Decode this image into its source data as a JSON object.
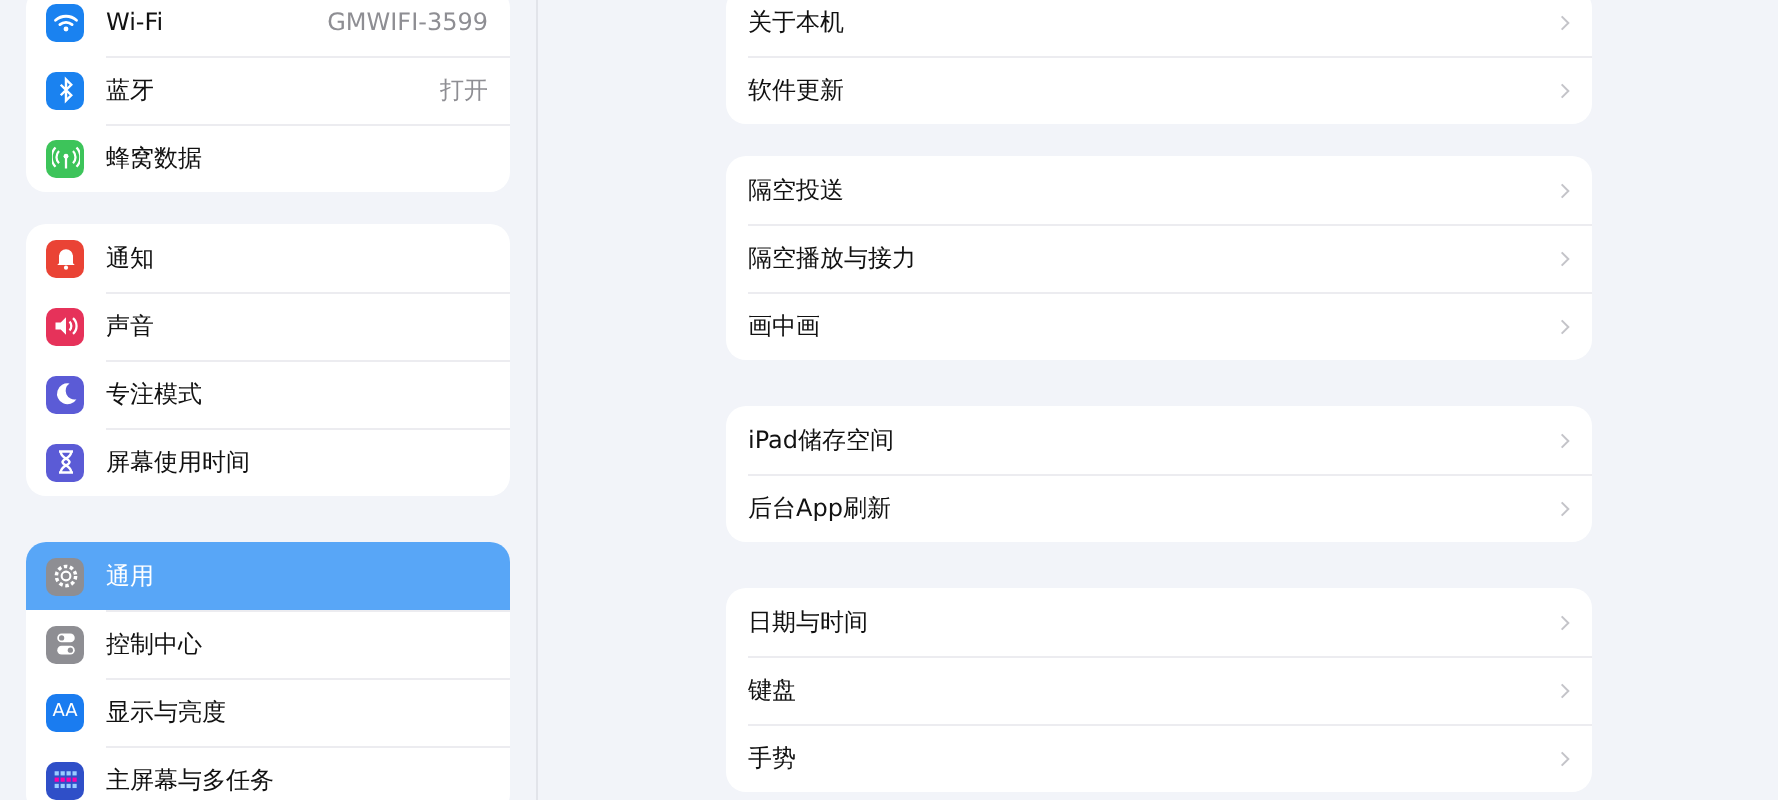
{
  "sidebar": {
    "groups": [
      {
        "items": [
          {
            "kind": "wifi",
            "color": "#1a82f0",
            "label": "Wi-Fi",
            "value": "GMWIFI-3599",
            "selected": false
          },
          {
            "kind": "bluetooth",
            "color": "#1a82f0",
            "label": "蓝牙",
            "value": "打开",
            "selected": false
          },
          {
            "kind": "cellular",
            "color": "#3dc45a",
            "label": "蜂窝数据",
            "selected": false
          }
        ]
      },
      {
        "items": [
          {
            "kind": "bell",
            "color": "#ea4335",
            "label": "通知",
            "selected": false
          },
          {
            "kind": "speaker",
            "color": "#e6325a",
            "label": "声音",
            "selected": false
          },
          {
            "kind": "moon",
            "color": "#5b5bd6",
            "label": "专注模式",
            "selected": false
          },
          {
            "kind": "hourglass",
            "color": "#5b5bd6",
            "label": "屏幕使用时间",
            "selected": false
          }
        ]
      },
      {
        "items": [
          {
            "kind": "gear",
            "color": "#8e8e93",
            "label": "通用",
            "selected": true
          },
          {
            "kind": "toggles",
            "color": "#8e8e93",
            "label": "控制中心",
            "selected": false
          },
          {
            "kind": "text",
            "color": "#1a7cf0",
            "label": "显示与亮度",
            "glyph": "AA",
            "selected": false
          },
          {
            "kind": "grid",
            "color": "#2f4fc8",
            "label": "主屏幕与多任务",
            "selected": false
          }
        ]
      }
    ]
  },
  "detail": {
    "groups": [
      {
        "items": [
          "关于本机",
          "软件更新"
        ]
      },
      {
        "items": [
          "隔空投送",
          "隔空播放与接力",
          "画中画"
        ]
      },
      {
        "items": [
          "iPad储存空间",
          "后台App刷新"
        ]
      },
      {
        "items": [
          "日期与时间",
          "键盘",
          "手势"
        ]
      }
    ]
  }
}
